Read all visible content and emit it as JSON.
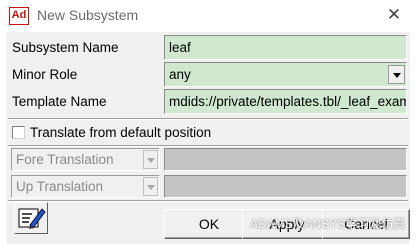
{
  "window": {
    "app_icon_text": "Ad",
    "title": "New Subsystem",
    "close_glyph": "✕"
  },
  "form": {
    "subsystem_name": {
      "label": "Subsystem Name",
      "value": "leaf"
    },
    "minor_role": {
      "label": "Minor Role",
      "value": "any"
    },
    "template_name": {
      "label": "Template Name",
      "value": "mdids://private/templates.tbl/_leaf_exam"
    }
  },
  "translate": {
    "checkbox_label": "Translate from default position",
    "checked": false,
    "fore_translation": {
      "label": "Fore Translation",
      "value": ""
    },
    "up_translation": {
      "label": "Up Translation",
      "value": ""
    }
  },
  "buttons": {
    "comment_icon": "comment-edit-icon",
    "ok": "OK",
    "apply": "Apply",
    "cancel": "Cancel"
  },
  "watermark": "ADAMS及ANSYS学习及仿真",
  "colors": {
    "field_green": "#cfe8cf",
    "dialog_bg": "#f0f0f0",
    "app_icon_red": "#cc1111",
    "disabled_field": "#c4c4c4"
  }
}
